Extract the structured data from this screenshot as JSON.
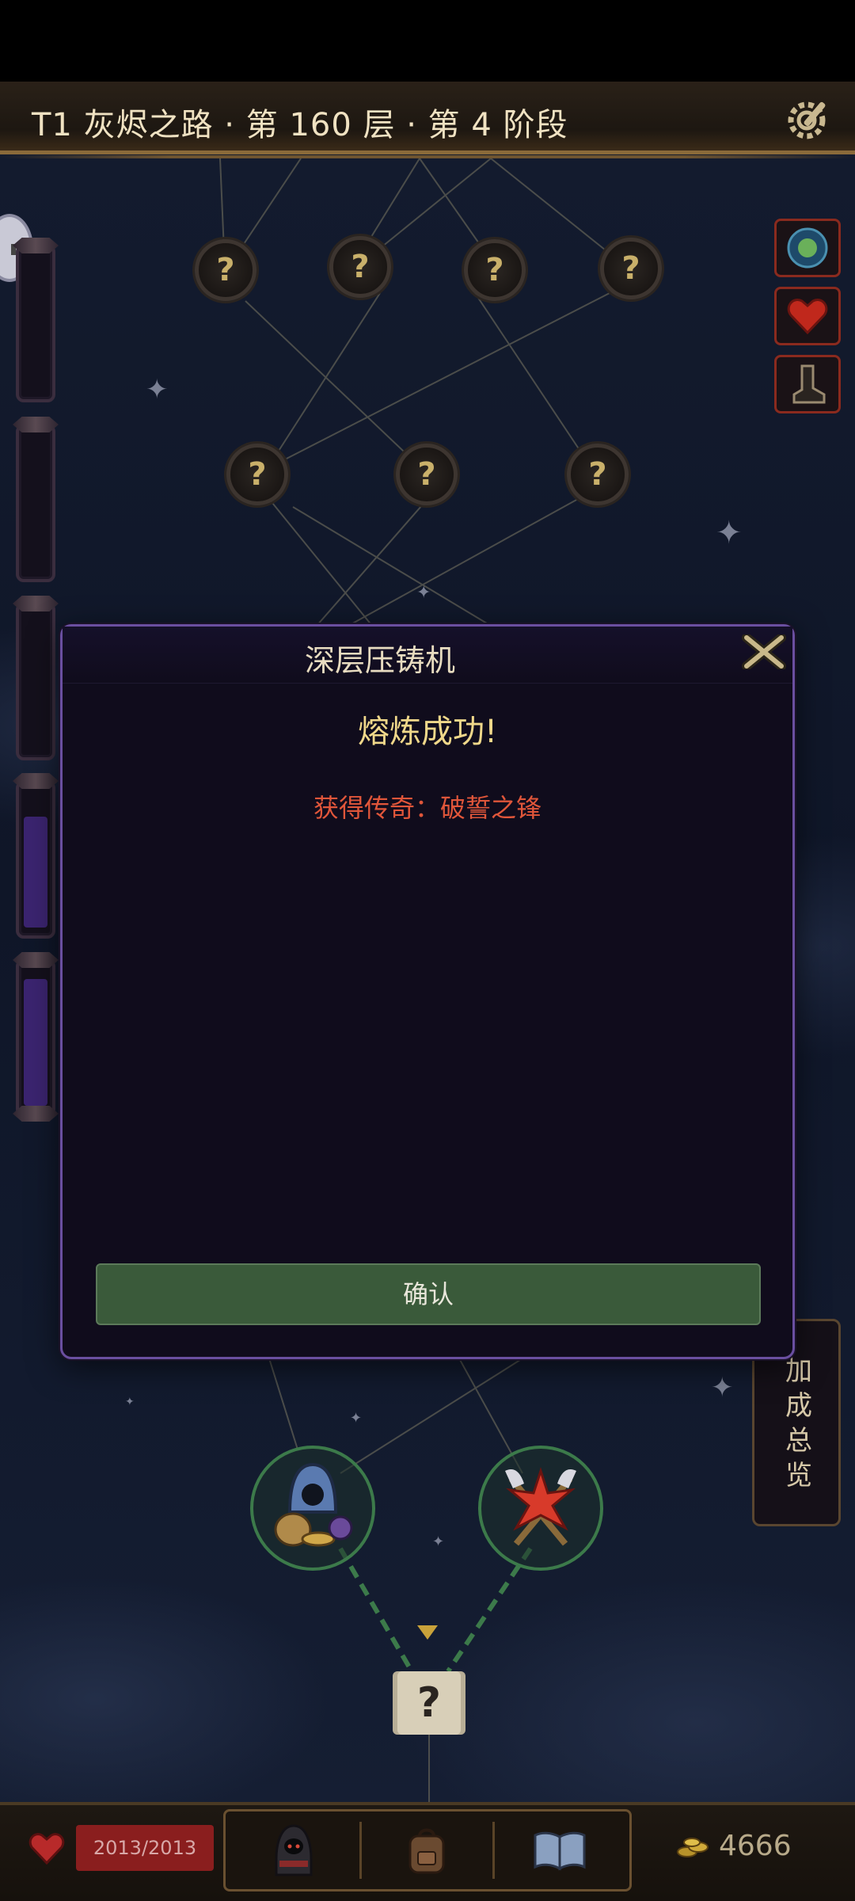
{
  "header": {
    "title": "T1 灰烬之路 · 第 160 层 · 第 4 阶段"
  },
  "map": {
    "unknown_node_symbol": "?",
    "progress_tubes": [
      {
        "fill": 0.0
      },
      {
        "fill": 0.0
      },
      {
        "fill": 0.0
      },
      {
        "fill": 0.75
      },
      {
        "fill": 0.9
      }
    ]
  },
  "icons": {
    "settings": "gear-wrench-icon",
    "buffs": [
      "globe-emblem-icon",
      "red-heart-icon",
      "boot-icon"
    ],
    "events": [
      "hooded-merchant-icon",
      "crossed-axes-icon"
    ],
    "mystery": "question-scroll-icon"
  },
  "modal": {
    "title": "深层压铸机",
    "success": "熔炼成功!",
    "reward": "获得传奇：破誓之锋",
    "confirm_label": "确认"
  },
  "side": {
    "bonus_label": "加成总览"
  },
  "bottom": {
    "hp": "2013/2013",
    "gold": "4666"
  },
  "colors": {
    "modal_border": "#6a4fa0",
    "reward_text": "#e0563a",
    "success_text": "#f0d88a",
    "confirm_button": "#3a5a3a",
    "hp_bar": "#8a1e1e"
  }
}
